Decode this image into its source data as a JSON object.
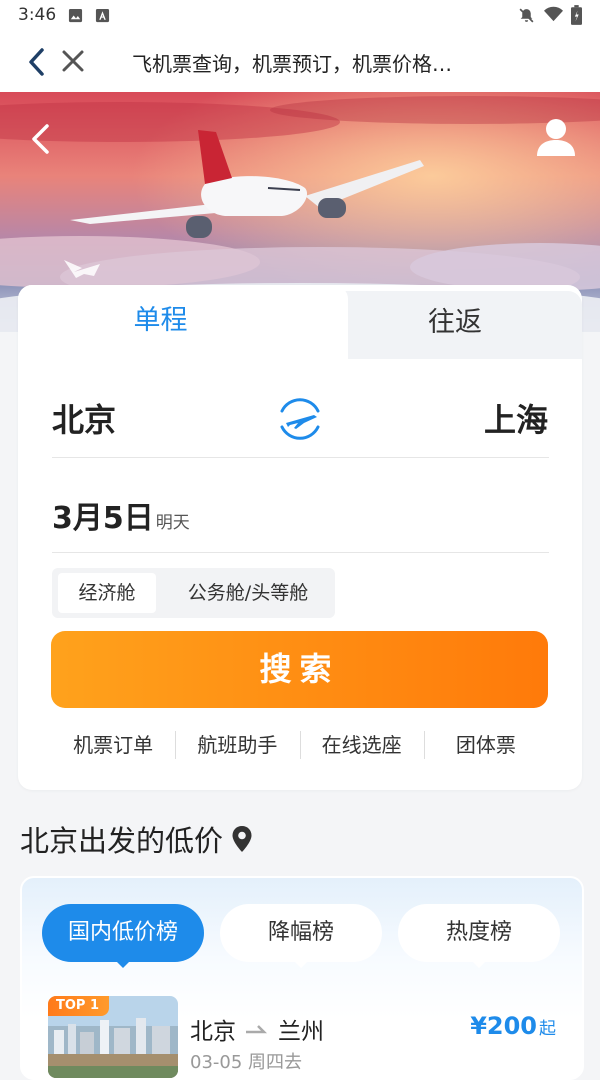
{
  "status_bar": {
    "time": "3:46",
    "icons": [
      "image-icon",
      "text-a-icon",
      "bell-off-icon",
      "wifi-icon",
      "battery-icon"
    ]
  },
  "top_bar": {
    "title": "飞机票查询，机票预订，机票价格…"
  },
  "search_card": {
    "tabs": [
      "单程",
      "往返"
    ],
    "active_tab": "单程",
    "from_city": "北京",
    "to_city": "上海",
    "date": "3月5日",
    "date_hint": "明天",
    "cabins": [
      "经济舱",
      "公务舱/头等舱"
    ],
    "selected_cabin": "经济舱",
    "search_label": "搜索",
    "quick_links": [
      "机票订单",
      "航班助手",
      "在线选座",
      "团体票"
    ]
  },
  "low_price": {
    "title": "北京出发的低价",
    "tabs": [
      "国内低价榜",
      "降幅榜",
      "热度榜"
    ],
    "active_tab": "国内低价榜",
    "items": [
      {
        "badge": "TOP 1",
        "from": "北京",
        "to": "兰州",
        "date": "03-05 周四去",
        "price": "¥200",
        "price_suffix": "起"
      }
    ]
  },
  "colors": {
    "accent": "#1e8bea",
    "search_start": "#ffa21c",
    "search_end": "#ff7a0a",
    "badge": "#ff7a1a"
  }
}
